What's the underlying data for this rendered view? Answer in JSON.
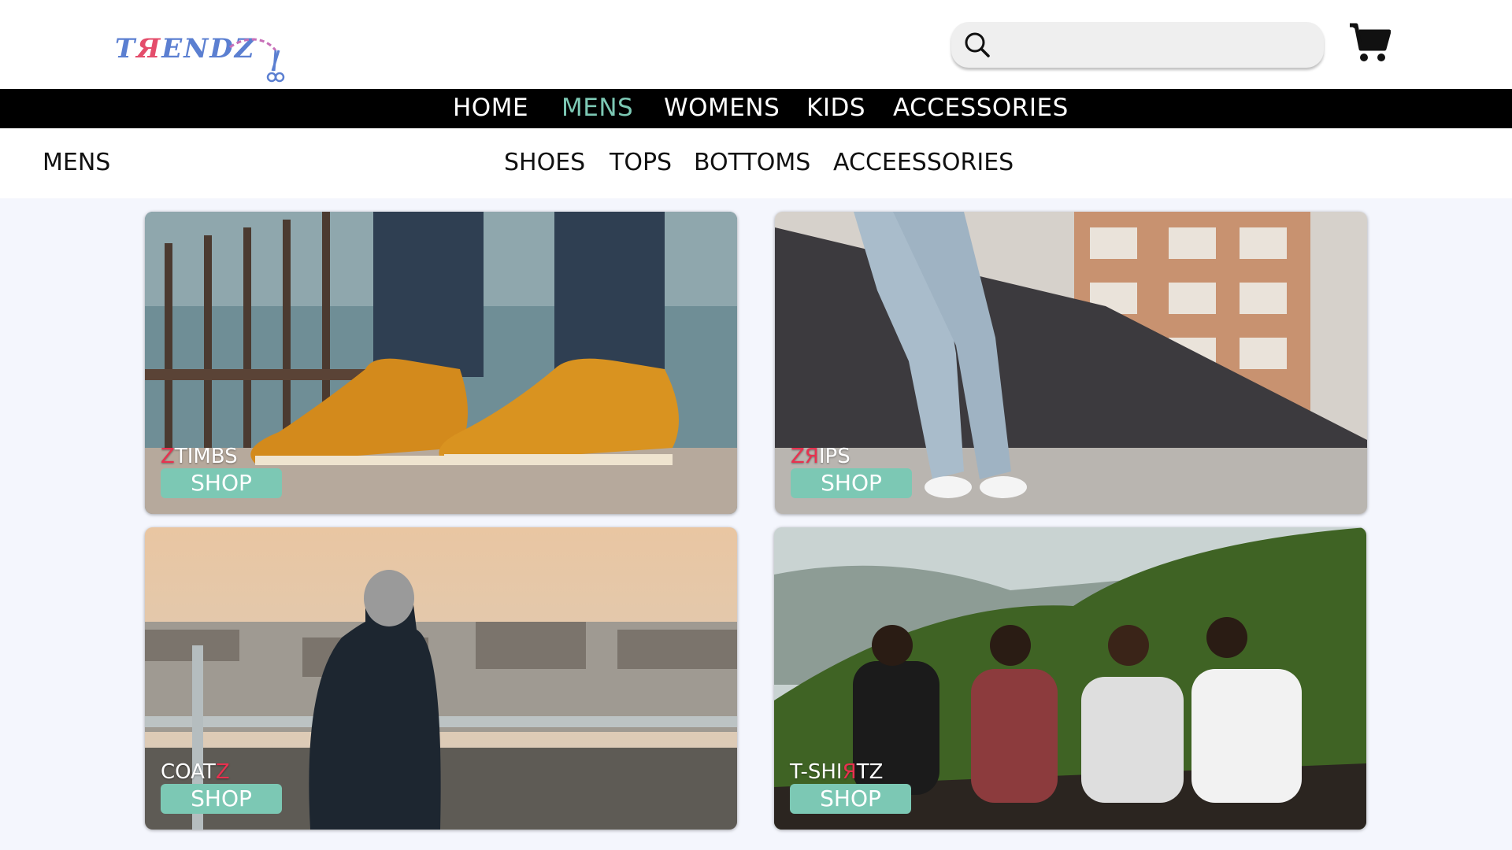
{
  "header": {
    "logo": {
      "part1": "T",
      "part2": "Я",
      "part3": "ENDZ"
    },
    "search": {
      "placeholder": "",
      "value": ""
    }
  },
  "mainnav": {
    "items": [
      {
        "label": "HOME",
        "active": false
      },
      {
        "label": "MENS",
        "active": true
      },
      {
        "label": "WOMENS",
        "active": false
      },
      {
        "label": "KIDS",
        "active": false
      },
      {
        "label": "ACCESSORIES",
        "active": false
      }
    ]
  },
  "subnav": {
    "section_title": "MENS",
    "items": [
      "SHOES",
      "TOPS",
      "BOTTOMS",
      "ACCEESSORIES"
    ]
  },
  "cards": [
    {
      "label_red": "Z",
      "label_rest": "TIMBS",
      "button": "SHOP"
    },
    {
      "label_red": "ZЯ",
      "label_rest": "IPS",
      "button": "SHOP"
    },
    {
      "label_pre": "COAT",
      "label_red": "Z",
      "button": "SHOP"
    },
    {
      "label_a": "T-SHI",
      "label_red": "Я",
      "label_b": "TZ",
      "button": "SHOP"
    }
  ],
  "colors": {
    "accent": "#7cc8b4",
    "red": "#e8314f",
    "nav_bg": "#000000",
    "page_bg": "#f4f6fd"
  }
}
